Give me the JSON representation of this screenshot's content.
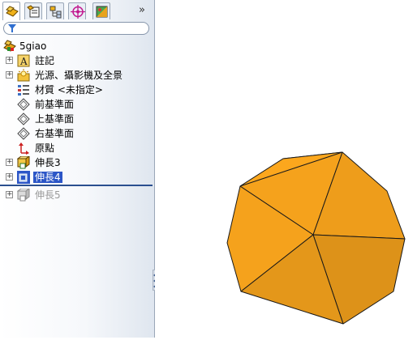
{
  "tabs": [
    {
      "name": "featuremanager-icon",
      "active": true
    },
    {
      "name": "propertymanager-icon",
      "active": false
    },
    {
      "name": "configurationmanager-icon",
      "active": false
    },
    {
      "name": "dimxpert-icon",
      "active": false
    },
    {
      "name": "display-manager-icon",
      "active": false
    }
  ],
  "tab_overflow": "»",
  "filter": {
    "value": "",
    "icon": "filter-icon"
  },
  "tree": {
    "root": "5giao",
    "items": [
      {
        "label": "註記",
        "icon": "annotations-icon",
        "expandable": true
      },
      {
        "label": "光源、攝影機及全景",
        "icon": "lights-icon",
        "expandable": true
      },
      {
        "label": "材質 <未指定>",
        "icon": "material-icon",
        "expandable": false
      },
      {
        "label": "前基準面",
        "icon": "plane-icon",
        "expandable": false
      },
      {
        "label": "上基準面",
        "icon": "plane-icon",
        "expandable": false
      },
      {
        "label": "右基準面",
        "icon": "plane-icon",
        "expandable": false
      },
      {
        "label": "原點",
        "icon": "origin-icon",
        "expandable": false
      },
      {
        "label": "伸長3",
        "icon": "extrude-icon",
        "expandable": true
      },
      {
        "label": "伸長4",
        "icon": "extrude-icon",
        "expandable": true,
        "selected": true
      },
      {
        "label": "伸長5",
        "icon": "extrude-icon",
        "expandable": true,
        "suppressed": true
      }
    ]
  },
  "model": {
    "color": "#f5a21c",
    "edge_color": "#1a1a1a"
  }
}
